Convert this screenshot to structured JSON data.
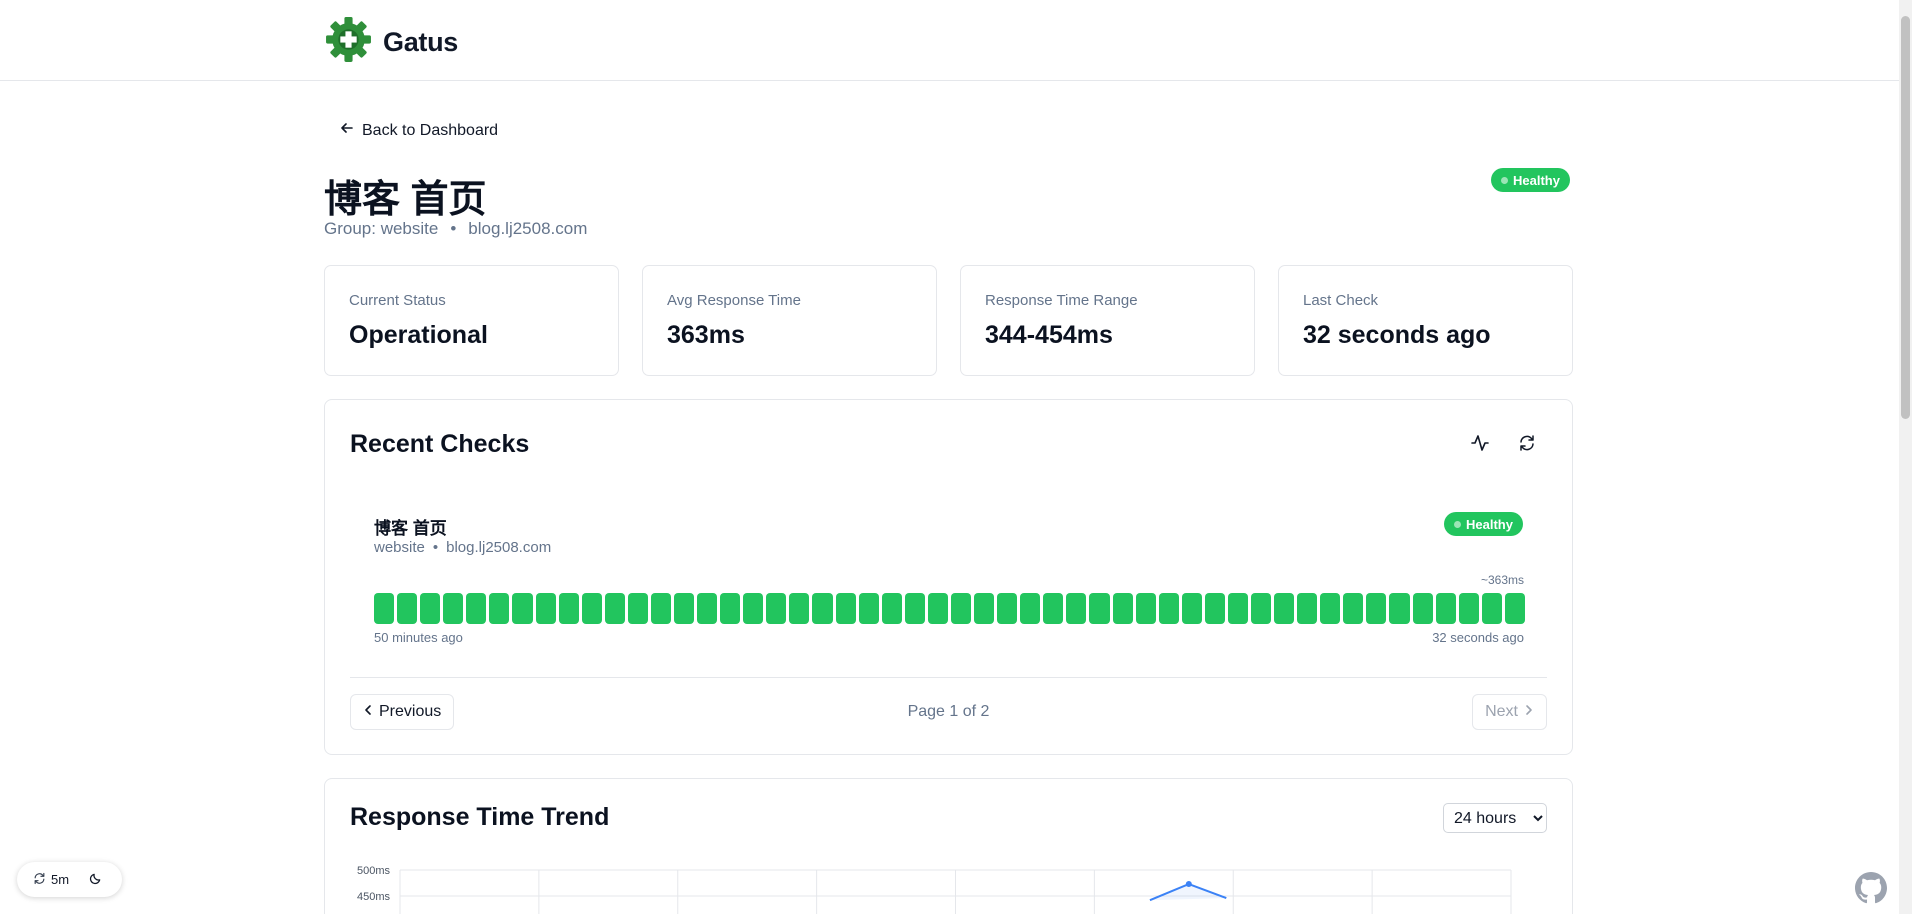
{
  "app": {
    "name": "Gatus"
  },
  "nav": {
    "back_label": "Back to Dashboard"
  },
  "endpoint": {
    "title": "博客 首页",
    "group_text": "Group: website",
    "separator": "•",
    "host": "blog.lj2508.com",
    "status_badge": "Healthy",
    "status_color": "#22c55e"
  },
  "stats": [
    {
      "label": "Current Status",
      "value": "Operational"
    },
    {
      "label": "Avg Response Time",
      "value": "363ms"
    },
    {
      "label": "Response Time Range",
      "value": "344-454ms"
    },
    {
      "label": "Last Check",
      "value": "32 seconds ago"
    }
  ],
  "recent": {
    "title": "Recent Checks",
    "endpoint_name": "博客 首页",
    "group": "website",
    "separator": "•",
    "host": "blog.lj2508.com",
    "badge": "Healthy",
    "avg_note": "~363ms",
    "results": [
      "success",
      "success",
      "success",
      "success",
      "success",
      "success",
      "success",
      "success",
      "success",
      "success",
      "success",
      "success",
      "success",
      "success",
      "success",
      "success",
      "success",
      "success",
      "success",
      "success",
      "success",
      "success",
      "success",
      "success",
      "success",
      "success",
      "success",
      "success",
      "success",
      "success",
      "success",
      "success",
      "success",
      "success",
      "success",
      "success",
      "success",
      "success",
      "success",
      "success",
      "success",
      "success",
      "success",
      "success",
      "success",
      "success",
      "success",
      "success",
      "success",
      "success"
    ],
    "success_color": "#22c55e",
    "oldest_label": "50 minutes ago",
    "newest_label": "32 seconds ago",
    "prev_label": "Previous",
    "next_label": "Next",
    "page_info": "Page 1 of 2"
  },
  "trend": {
    "title": "Response Time Trend",
    "range_options": [
      "24 hours"
    ],
    "selected_range": "24 hours"
  },
  "chart_data": {
    "type": "line",
    "y_ticks": [
      "500ms",
      "450ms"
    ],
    "ylim": [
      400,
      500
    ],
    "grid": true,
    "line_color": "#3b82f6",
    "points": [
      {
        "x_index": 5.4,
        "y": 442
      },
      {
        "x_index": 5.68,
        "y": 473
      },
      {
        "x_index": 5.95,
        "y": 446
      }
    ],
    "x_slots": 8
  },
  "footer": {
    "refresh_interval": "5m"
  },
  "icons": {
    "logo": "gatus-gear-logo",
    "back": "arrow-left-icon",
    "activity": "activity-icon",
    "refresh": "refresh-icon",
    "moon": "moon-icon",
    "github": "github-icon"
  }
}
